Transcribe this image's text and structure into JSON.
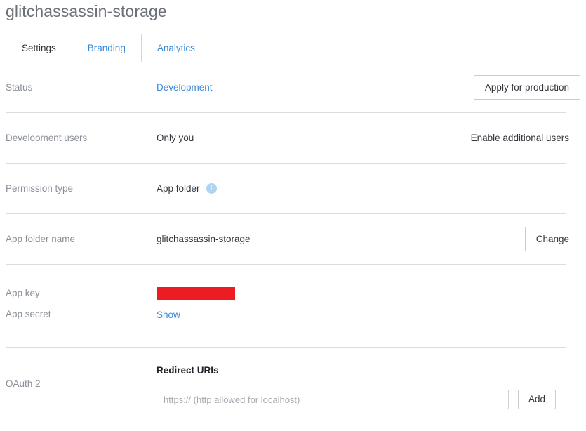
{
  "page": {
    "title": "glitchassassin-storage"
  },
  "tabs": [
    {
      "label": "Settings",
      "active": true
    },
    {
      "label": "Branding",
      "active": false
    },
    {
      "label": "Analytics",
      "active": false
    }
  ],
  "rows": {
    "status": {
      "label": "Status",
      "value": "Development",
      "button": "Apply for production"
    },
    "development_users": {
      "label": "Development users",
      "value": "Only you",
      "button": "Enable additional users"
    },
    "permission_type": {
      "label": "Permission type",
      "value": "App folder",
      "info_icon": "i"
    },
    "app_folder_name": {
      "label": "App folder name",
      "value": "glitchassassin-storage",
      "button": "Change"
    },
    "app_key": {
      "label": "App key",
      "value": ""
    },
    "app_secret": {
      "label": "App secret",
      "value": "Show"
    },
    "oauth": {
      "label": "OAuth 2",
      "heading": "Redirect URIs",
      "input_value": "",
      "input_placeholder": "https:// (http allowed for localhost)",
      "button": "Add"
    }
  },
  "colors": {
    "link": "#3b88da",
    "label": "#8a8f99",
    "redaction": "#ec1c24",
    "info_icon": "#aed4ef",
    "tab_border": "#bcdcf7",
    "divider": "#dcdcdc"
  }
}
